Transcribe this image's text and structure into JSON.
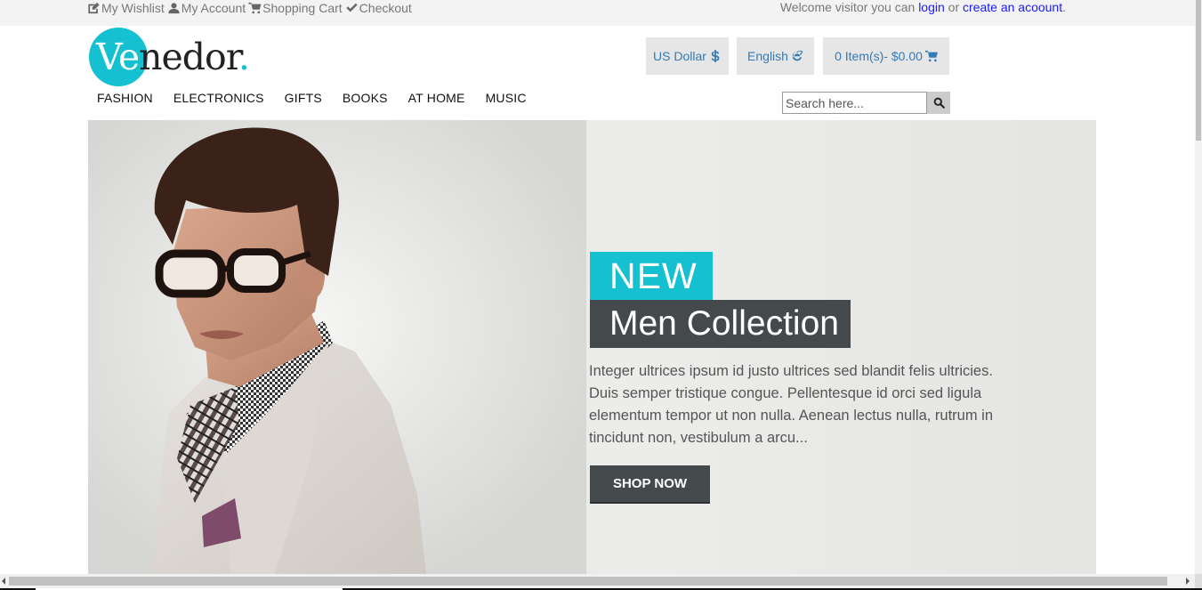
{
  "topbar": {
    "links": [
      {
        "label": "My Wishlist",
        "icon": "edit-icon"
      },
      {
        "label": "My Account",
        "icon": "user-icon"
      },
      {
        "label": "Shopping Cart",
        "icon": "cart-icon"
      },
      {
        "label": "Checkout",
        "icon": "check-icon"
      }
    ],
    "welcome_prefix": "Welcome visitor you can ",
    "login": "login",
    "or": " or ",
    "create_account": "create an acoount",
    "suffix": "."
  },
  "logo": {
    "part_accent": "Ve",
    "part_main": "nedor",
    "dot": "."
  },
  "header": {
    "currency": "US Dollar",
    "language": "English",
    "cart": "0 Item(s)- $0.00"
  },
  "nav": {
    "items": [
      "FASHION",
      "ELECTRONICS",
      "GIFTS",
      "BOOKS",
      "AT HOME",
      "MUSIC"
    ]
  },
  "search": {
    "placeholder": "Search here..."
  },
  "hero": {
    "badge": "NEW",
    "title": "Men Collection",
    "description": "Integer ultrices ipsum id justo ultrices sed blandit felis ultricies. Duis semper tristique congue. Pellentesque id orci sed ligula elementum tempor ut non nulla. Aenean lectus nulla, rutrum in tincidunt non, vestibulum a arcu...",
    "button": "SHOP NOW"
  },
  "colors": {
    "accent": "#15c1d0",
    "dark": "#444a4c",
    "link": "#337ab7"
  }
}
